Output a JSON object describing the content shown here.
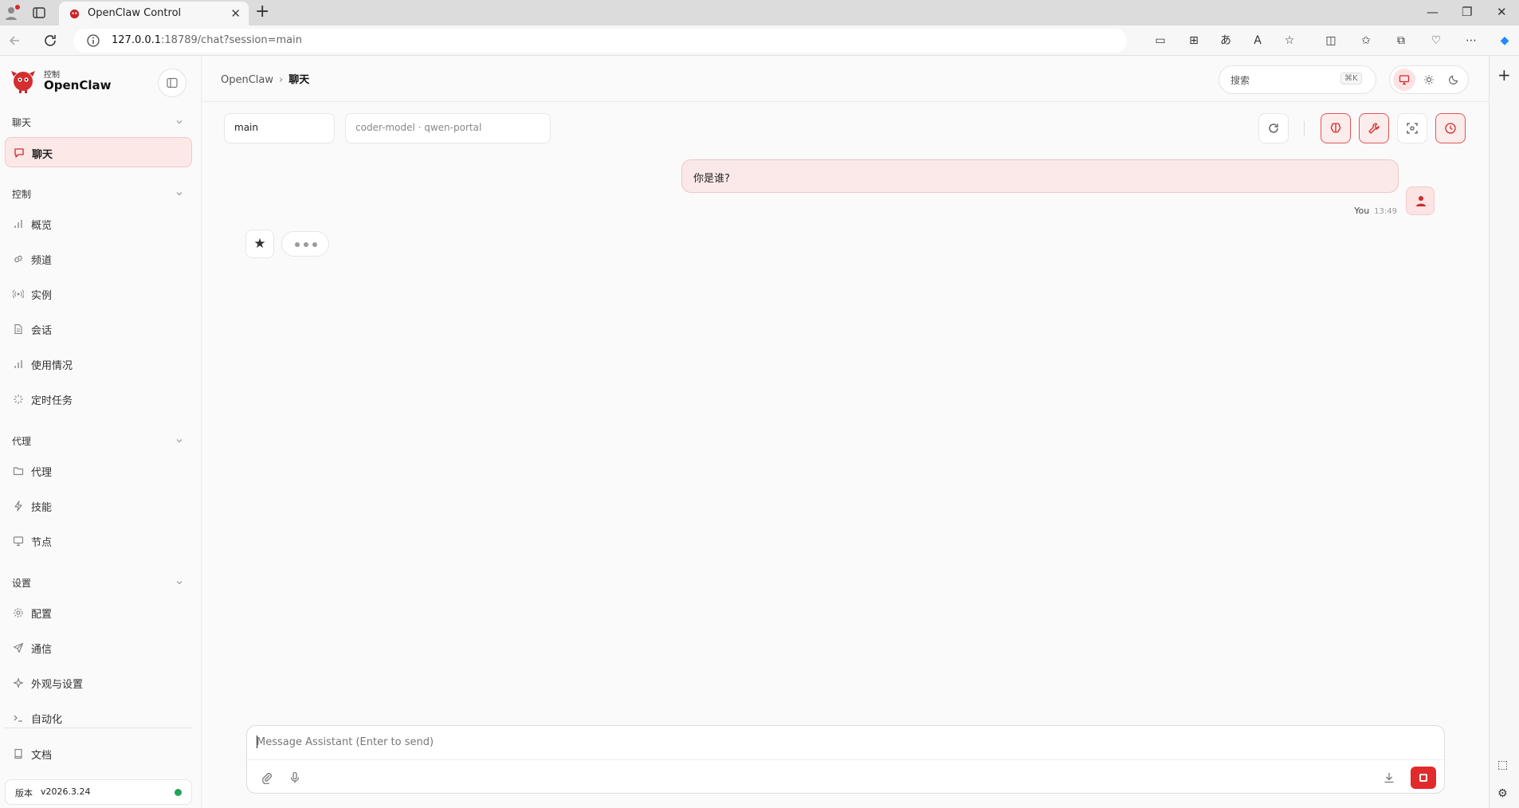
{
  "browser": {
    "tab_title": "OpenClaw Control",
    "url_host": "127.0.0.1",
    "url_rest": ":18789/chat?session=main"
  },
  "sidebar": {
    "brand_sub": "控制",
    "brand_name": "OpenClaw",
    "groups": [
      {
        "label": "聊天",
        "items": [
          {
            "label": "聊天",
            "icon": "chat-icon",
            "active": true
          }
        ]
      },
      {
        "label": "控制",
        "items": [
          {
            "label": "概览",
            "icon": "bar-chart-icon"
          },
          {
            "label": "频道",
            "icon": "link-icon"
          },
          {
            "label": "实例",
            "icon": "radio-icon"
          },
          {
            "label": "会话",
            "icon": "document-icon"
          },
          {
            "label": "使用情况",
            "icon": "bar-chart-icon"
          },
          {
            "label": "定时任务",
            "icon": "loader-icon"
          }
        ]
      },
      {
        "label": "代理",
        "items": [
          {
            "label": "代理",
            "icon": "folder-icon"
          },
          {
            "label": "技能",
            "icon": "zap-icon"
          },
          {
            "label": "节点",
            "icon": "monitor-icon"
          }
        ]
      },
      {
        "label": "设置",
        "items": [
          {
            "label": "配置",
            "icon": "gear-icon"
          },
          {
            "label": "通信",
            "icon": "send-icon"
          },
          {
            "label": "外观与设置",
            "icon": "sparkle-icon"
          },
          {
            "label": "自动化",
            "icon": "terminal-icon"
          }
        ]
      }
    ],
    "docs_label": "文档",
    "version_key": "版本",
    "version_value": "v2026.3.24",
    "status_color": "#22a35a"
  },
  "header": {
    "breadcrumb_root": "OpenClaw",
    "breadcrumb_sep": "›",
    "breadcrumb_current": "聊天",
    "search_placeholder": "搜索",
    "search_shortcut": "⌘K",
    "theme_active": "system"
  },
  "chat": {
    "session_value": "main",
    "model_value": "coder-model · qwen-portal",
    "messages": [
      {
        "role": "user",
        "text": "你是谁?",
        "author": "You",
        "time": "13:49"
      }
    ],
    "assistant_typing": true,
    "composer_placeholder": "Message Assistant (Enter to send)"
  },
  "colors": {
    "accent": "#e12a2a",
    "accent_soft": "#fde8e8"
  }
}
